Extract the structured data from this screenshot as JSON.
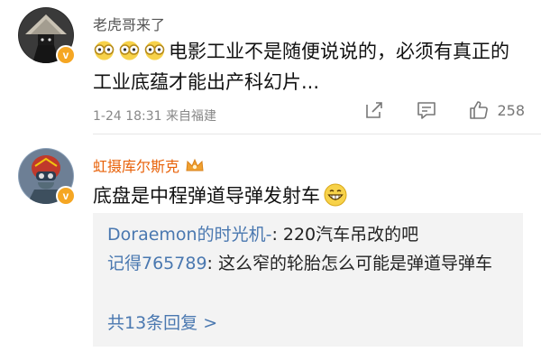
{
  "comments": [
    {
      "username": "老虎哥来了",
      "text": "电影工业不是随便说说的，必须有真正的工业底蕴才能出产科幻片...",
      "timestamp": "1-24 18:31",
      "source": "来自福建",
      "like_count": "258",
      "emojis": [
        "glasses-face-emoji",
        "glasses-face-emoji",
        "glasses-face-emoji"
      ]
    },
    {
      "username": "虹摄库尔斯克",
      "text": "底盘是中程弹道导弹发射车",
      "emoji": "grin-emoji",
      "replies": [
        {
          "name": "Doraemon的时光机-",
          "text": ": 220汽车吊改的吧"
        },
        {
          "name": "记得765789",
          "text": ": 这么窄的轮胎怎么可能是弹道导弹车"
        }
      ],
      "more_replies": "共13条回复 >"
    }
  ],
  "colors": {
    "username_highlight": "#e8620a",
    "reply_name": "#4a78b0",
    "verified_badge": "#f5a623",
    "reply_bg": "#f3f3f3",
    "meta_text": "#888888"
  },
  "icons": {
    "share": "share-icon",
    "comment": "comment-icon",
    "like": "thumbs-up-icon",
    "verified": "verified-v-icon",
    "member": "crown-icon"
  }
}
